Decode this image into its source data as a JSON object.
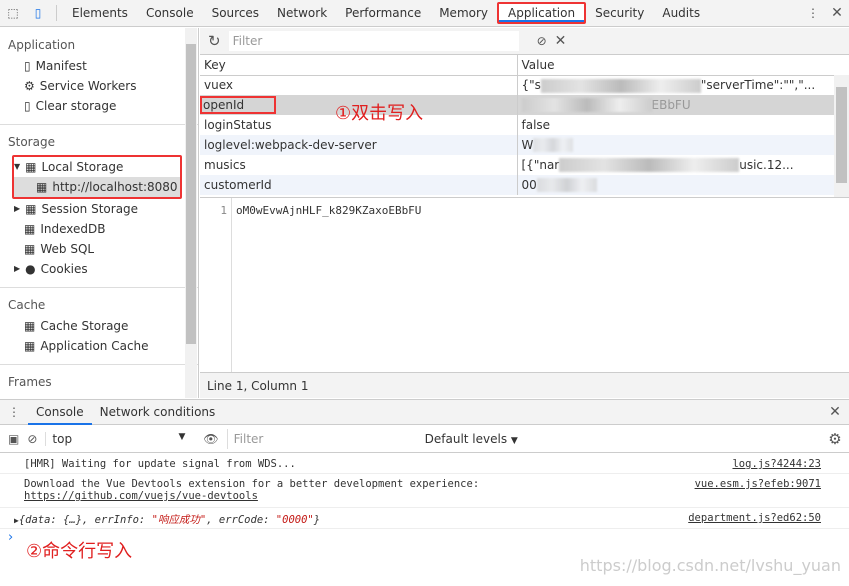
{
  "toolbar": {
    "tabs": [
      "Elements",
      "Console",
      "Sources",
      "Network",
      "Performance",
      "Memory",
      "Application",
      "Security",
      "Audits"
    ],
    "active": "Application"
  },
  "sidebar": {
    "application": {
      "title": "Application",
      "items": [
        "Manifest",
        "Service Workers",
        "Clear storage"
      ]
    },
    "storage": {
      "title": "Storage",
      "local_storage": "Local Storage",
      "origin": "http://localhost:8080",
      "items": [
        "Session Storage",
        "IndexedDB",
        "Web SQL",
        "Cookies"
      ]
    },
    "cache": {
      "title": "Cache",
      "items": [
        "Cache Storage",
        "Application Cache"
      ]
    },
    "frames": {
      "title": "Frames"
    }
  },
  "storage_view": {
    "filter_placeholder": "Filter",
    "columns": [
      "Key",
      "Value"
    ],
    "rows": [
      {
        "key": "vuex",
        "value_start": "{\"s",
        "value_end": "\"serverTime\":\"\",\"..."
      },
      {
        "key": "openId",
        "value_start": "",
        "value_end": "EBbFU"
      },
      {
        "key": "loginStatus",
        "value_start": "false",
        "value_end": ""
      },
      {
        "key": "loglevel:webpack-dev-server",
        "value_start": "W",
        "value_end": ""
      },
      {
        "key": "musics",
        "value_start": "[{\"nar",
        "value_end": "usic.12..."
      },
      {
        "key": "customerId",
        "value_start": "00",
        "value_end": ""
      }
    ],
    "selected_key": "openId",
    "editor": {
      "line_number": "1",
      "content": "oM0wEvwAjnHLF_k829KZaxoEBbFU"
    },
    "status": "Line 1, Column 1"
  },
  "annotations": {
    "first": "①双击写入",
    "second": "②命令行写入",
    "accent": "#e02020"
  },
  "drawer": {
    "tabs": [
      "Console",
      "Network conditions"
    ],
    "active": "Console"
  },
  "console": {
    "context": "top",
    "filter_placeholder": "Filter",
    "levels": "Default levels",
    "messages": [
      {
        "text": "[HMR] Waiting for update signal from WDS...",
        "source": "log.js?4244:23"
      },
      {
        "text": "Download the Vue Devtools extension for a better development experience:",
        "link": "https://github.com/vuejs/vue-devtools",
        "source": "vue.esm.js?efeb:9071"
      },
      {
        "obj_prefix": "{data: {…}, errInfo: ",
        "errInfo": "\"响应成功\"",
        "mid": ", errCode: ",
        "errCode": "\"0000\"",
        "suffix": "}",
        "source": "department.js?ed62:50"
      }
    ]
  },
  "watermark": "https://blog.csdn.net/lvshu_yuan"
}
